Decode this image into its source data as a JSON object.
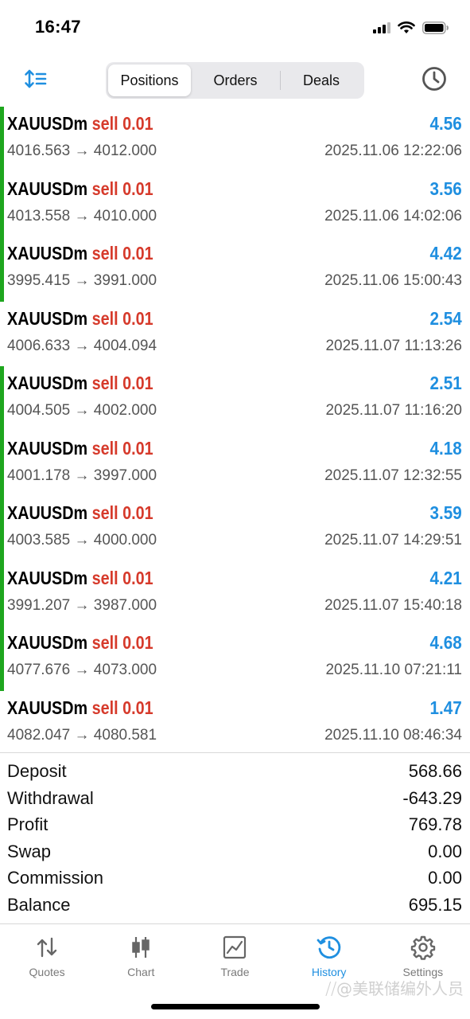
{
  "status_bar": {
    "time": "16:47"
  },
  "toolbar": {
    "tabs": [
      {
        "label": "Positions",
        "active": true
      },
      {
        "label": "Orders",
        "active": false
      },
      {
        "label": "Deals",
        "active": false
      }
    ]
  },
  "deals": [
    {
      "symbol": "XAUUSDm",
      "side": "sell",
      "volume": "0.01",
      "profit": "4.56",
      "prices": "4016.563 → 4012.000",
      "time": "2025.11.06 12:22:06",
      "marker": true
    },
    {
      "symbol": "XAUUSDm",
      "side": "sell",
      "volume": "0.01",
      "profit": "3.56",
      "prices": "4013.558 → 4010.000",
      "time": "2025.11.06 14:02:06",
      "marker": true
    },
    {
      "symbol": "XAUUSDm",
      "side": "sell",
      "volume": "0.01",
      "profit": "4.42",
      "prices": "3995.415 → 3991.000",
      "time": "2025.11.06 15:00:43",
      "marker": true
    },
    {
      "symbol": "XAUUSDm",
      "side": "sell",
      "volume": "0.01",
      "profit": "2.54",
      "prices": "4006.633 → 4004.094",
      "time": "2025.11.07 11:13:26",
      "marker": false
    },
    {
      "symbol": "XAUUSDm",
      "side": "sell",
      "volume": "0.01",
      "profit": "2.51",
      "prices": "4004.505 → 4002.000",
      "time": "2025.11.07 11:16:20",
      "marker": true
    },
    {
      "symbol": "XAUUSDm",
      "side": "sell",
      "volume": "0.01",
      "profit": "4.18",
      "prices": "4001.178 → 3997.000",
      "time": "2025.11.07 12:32:55",
      "marker": true
    },
    {
      "symbol": "XAUUSDm",
      "side": "sell",
      "volume": "0.01",
      "profit": "3.59",
      "prices": "4003.585 → 4000.000",
      "time": "2025.11.07 14:29:51",
      "marker": true
    },
    {
      "symbol": "XAUUSDm",
      "side": "sell",
      "volume": "0.01",
      "profit": "4.21",
      "prices": "3991.207 → 3987.000",
      "time": "2025.11.07 15:40:18",
      "marker": true
    },
    {
      "symbol": "XAUUSDm",
      "side": "sell",
      "volume": "0.01",
      "profit": "4.68",
      "prices": "4077.676 → 4073.000",
      "time": "2025.11.10 07:21:11",
      "marker": true
    },
    {
      "symbol": "XAUUSDm",
      "side": "sell",
      "volume": "0.01",
      "profit": "1.47",
      "prices": "4082.047 → 4080.581",
      "time": "2025.11.10 08:46:34",
      "marker": false
    }
  ],
  "summary": [
    {
      "label": "Deposit",
      "value": "568.66"
    },
    {
      "label": "Withdrawal",
      "value": "-643.29"
    },
    {
      "label": "Profit",
      "value": "769.78"
    },
    {
      "label": "Swap",
      "value": "0.00"
    },
    {
      "label": "Commission",
      "value": "0.00"
    },
    {
      "label": "Balance",
      "value": "695.15"
    }
  ],
  "tabbar": [
    {
      "label": "Quotes",
      "icon": "quotes-icon",
      "active": false
    },
    {
      "label": "Chart",
      "icon": "chart-icon",
      "active": false
    },
    {
      "label": "Trade",
      "icon": "trade-icon",
      "active": false
    },
    {
      "label": "History",
      "icon": "history-icon",
      "active": true
    },
    {
      "label": "Settings",
      "icon": "settings-icon",
      "active": false
    }
  ],
  "watermark": "⧸⧸@美联储编外人员",
  "colors": {
    "accent_blue": "#1f8fe0",
    "sell_red": "#d63a2b",
    "marker_green": "#1ea61e",
    "inactive_gray": "#7a7a7a"
  }
}
